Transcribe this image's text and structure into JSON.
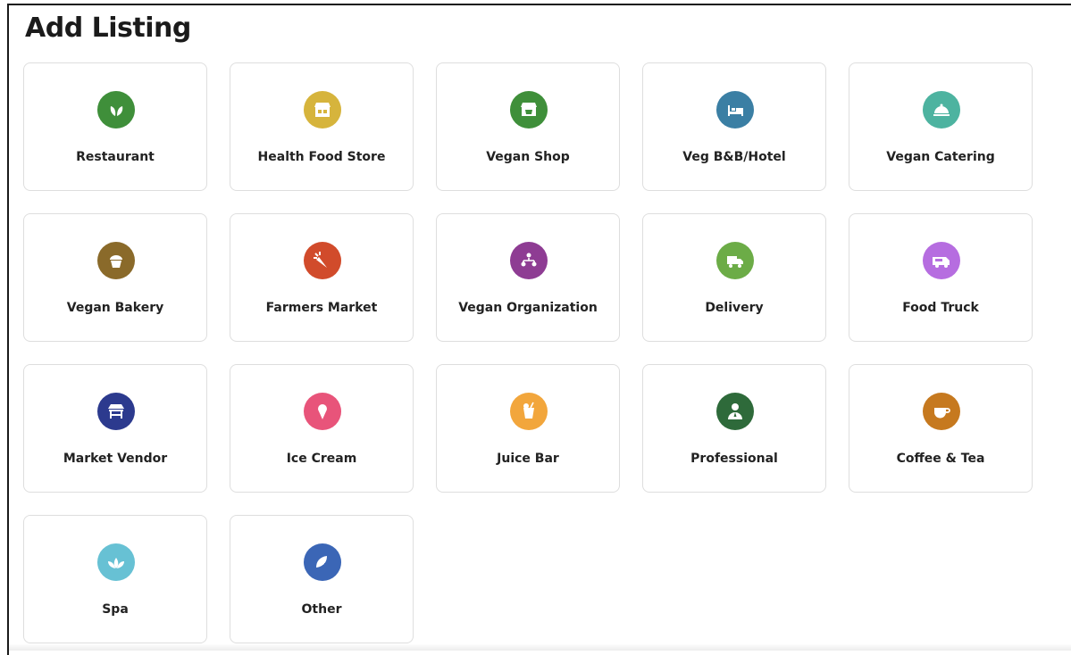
{
  "page": {
    "title": "Add Listing"
  },
  "listings": [
    {
      "label": "Restaurant",
      "icon": "leaf-icon",
      "color": "#3f8f3a"
    },
    {
      "label": "Health Food Store",
      "icon": "storefront-icon",
      "color": "#d6b43c"
    },
    {
      "label": "Vegan Shop",
      "icon": "shop-basket-icon",
      "color": "#3f8f3a"
    },
    {
      "label": "Veg B&B/Hotel",
      "icon": "bed-icon",
      "color": "#3b7fa4"
    },
    {
      "label": "Vegan Catering",
      "icon": "cloche-icon",
      "color": "#4db3a0"
    },
    {
      "label": "Vegan Bakery",
      "icon": "cupcake-icon",
      "color": "#8a6a2a"
    },
    {
      "label": "Farmers Market",
      "icon": "carrot-icon",
      "color": "#d14b2b"
    },
    {
      "label": "Vegan Organization",
      "icon": "org-chart-icon",
      "color": "#8e3c93"
    },
    {
      "label": "Delivery",
      "icon": "delivery-truck-icon",
      "color": "#6cac47"
    },
    {
      "label": "Food Truck",
      "icon": "food-truck-icon",
      "color": "#b66de0"
    },
    {
      "label": "Market Vendor",
      "icon": "market-stall-icon",
      "color": "#2c3a8e"
    },
    {
      "label": "Ice Cream",
      "icon": "ice-cream-icon",
      "color": "#e8547a"
    },
    {
      "label": "Juice Bar",
      "icon": "juice-icon",
      "color": "#f2a63c"
    },
    {
      "label": "Professional",
      "icon": "professional-person-icon",
      "color": "#2e6a3a"
    },
    {
      "label": "Coffee & Tea",
      "icon": "coffee-cup-icon",
      "color": "#c6791f"
    },
    {
      "label": "Spa",
      "icon": "lotus-icon",
      "color": "#67c1d4"
    },
    {
      "label": "Other",
      "icon": "leaf-plus-icon",
      "color": "#3b66b6"
    }
  ]
}
